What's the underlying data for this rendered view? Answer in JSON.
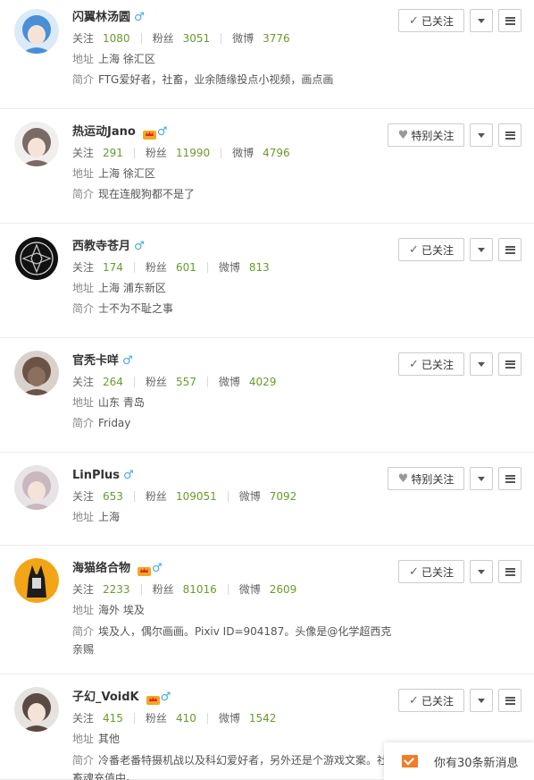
{
  "labels": {
    "follow": "关注",
    "fans": "粉丝",
    "weibo": "微博",
    "address": "地址",
    "intro": "简介"
  },
  "users": [
    {
      "name": "闪翼林汤圆",
      "gender": "♂",
      "vip": false,
      "following": "1080",
      "fans": "3051",
      "weibo": "3776",
      "address": "上海 徐汇区",
      "intro": "FTG爱好者，社畜，业余随缘投点小视频，画点画",
      "button": "已关注",
      "avatar_color": "#4a8ed6"
    },
    {
      "name": "热运动Jano",
      "gender": "♂",
      "vip": true,
      "following": "291",
      "fans": "11990",
      "weibo": "4796",
      "address": "上海 徐汇区",
      "intro": "现在连舰狗都不是了",
      "button": "特别关注",
      "avatar_color": "#7a6a66"
    },
    {
      "name": "西教寺苍月",
      "gender": "♂",
      "vip": false,
      "following": "174",
      "fans": "601",
      "weibo": "813",
      "address": "上海 浦东新区",
      "intro": "士不为不耻之事",
      "button": "已关注",
      "avatar_color": "#111111"
    },
    {
      "name": "官秃卡咩",
      "gender": "♂",
      "vip": false,
      "following": "264",
      "fans": "557",
      "weibo": "4029",
      "address": "山东 青岛",
      "intro": "Friday",
      "button": "已关注",
      "avatar_color": "#6b5446"
    },
    {
      "name": "LinPlus",
      "gender": "♂",
      "vip": false,
      "following": "653",
      "fans": "109051",
      "weibo": "7092",
      "address": "上海",
      "intro": "",
      "button": "特别关注",
      "avatar_color": "#c9b8bd"
    },
    {
      "name": "海猫络合物",
      "gender": "♂",
      "vip": true,
      "following": "2233",
      "fans": "81016",
      "weibo": "2609",
      "address": "海外 埃及",
      "intro": "埃及人，偶尔画画。Pixiv ID=904187。头像是@化学超西克亲赐",
      "button": "已关注",
      "avatar_color": "#f2a516"
    },
    {
      "name": "子幻_VoidK",
      "gender": "♂",
      "vip": true,
      "following": "415",
      "fans": "410",
      "weibo": "1542",
      "address": "其他",
      "intro": "冷番老番特摄机战以及科幻爱好者，另外还是个游戏文案。社畜魂充值中。",
      "button": "已关注",
      "avatar_color": "#5a4a44"
    }
  ],
  "toast": {
    "text": "你有30条新消息"
  },
  "colors": {
    "accent_number": "#6a9b2b",
    "gender_male": "#3fa9e0",
    "toast_icon": "#f07d2a"
  }
}
